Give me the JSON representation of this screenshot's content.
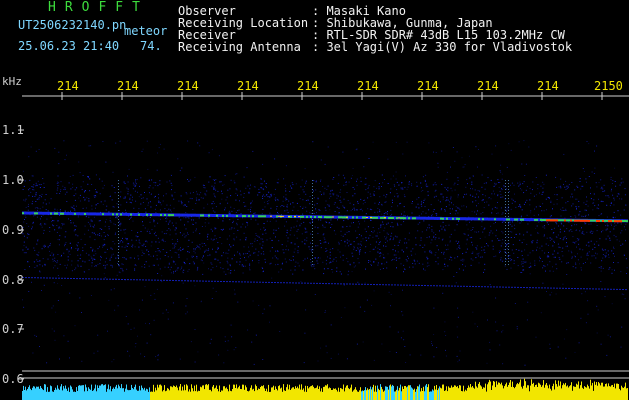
{
  "header": {
    "brand": "HROFFT",
    "filename": "UT2506232140.pn",
    "tag": "meteor",
    "datetime": "25.06.23 21:40",
    "count": "74.",
    "labels": {
      "observer": "Observer",
      "location": "Receiving Location",
      "receiver": "Receiver",
      "antenna": "Receiving Antenna"
    },
    "values": {
      "observer": ": Masaki Kano",
      "location": ": Shibukawa, Gunma, Japan",
      "receiver": ": RTL-SDR SDR# 43dB L15 103.2MHz CW",
      "antenna": ": 3el Yagi(V) Az 330 for Vladivostok"
    }
  },
  "axis": {
    "unit": "kHz",
    "time_ticks": [
      "214",
      "214",
      "214",
      "214",
      "214",
      "214",
      "214",
      "214",
      "214",
      "2150"
    ],
    "freq_ticks": [
      "1.1",
      "1.0",
      "0.9",
      "0.8",
      "0.7",
      "0.6"
    ]
  },
  "colors": {
    "background": "#000000",
    "signal_core": "#ff3c00",
    "signal_mid": "#39d25a",
    "noise": "#1a2bff",
    "level_yellow": "#f2e600",
    "level_cyan": "#36d0ff"
  }
}
